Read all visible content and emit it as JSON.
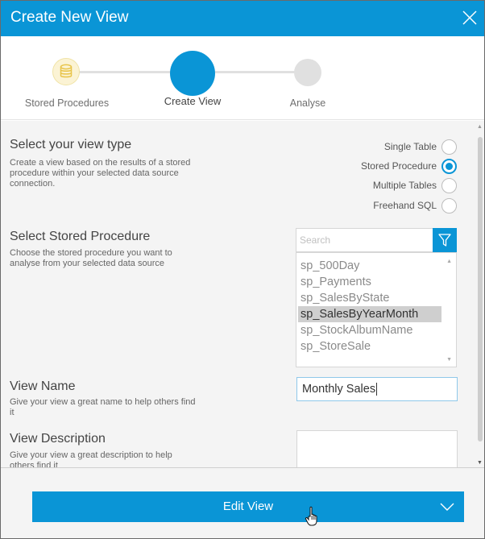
{
  "dialog": {
    "title": "Create New View",
    "close_icon": "close-icon"
  },
  "stepper": {
    "steps": [
      {
        "label": "Stored Procedures",
        "state": "done",
        "icon": "database-icon"
      },
      {
        "label": "Create View",
        "state": "active"
      },
      {
        "label": "Analyse",
        "state": "pending"
      }
    ]
  },
  "view_type": {
    "title": "Select your view type",
    "description_lines": [
      "Create a view based on the results of a stored",
      "procedure within your selected data source",
      "connection."
    ],
    "options": [
      {
        "label": "Single Table",
        "checked": false
      },
      {
        "label": "Stored Procedure",
        "checked": true
      },
      {
        "label": "Multiple Tables",
        "checked": false
      },
      {
        "label": "Freehand SQL",
        "checked": false
      }
    ]
  },
  "stored_procedure": {
    "title": "Select Stored Procedure",
    "description_lines": [
      "Choose the stored procedure you want to",
      "analyse from your selected data source"
    ],
    "search_placeholder": "Search",
    "filter_icon": "filter-icon",
    "items": [
      {
        "label": "sp_500Day",
        "selected": false
      },
      {
        "label": "sp_Payments",
        "selected": false
      },
      {
        "label": "sp_SalesByState",
        "selected": false
      },
      {
        "label": "sp_SalesByYearMonth",
        "selected": true
      },
      {
        "label": "sp_StockAlbumName",
        "selected": false
      },
      {
        "label": "sp_StoreSale",
        "selected": false
      }
    ]
  },
  "view_name": {
    "title": "View Name",
    "description_lines": [
      "Give your view a great name to help others find",
      "it"
    ],
    "value": "Monthly Sales"
  },
  "view_description": {
    "title": "View Description",
    "description_lines": [
      "Give your view a great description to help",
      "others find it"
    ],
    "value": ""
  },
  "footer": {
    "edit_button_label": "Edit View",
    "chevron_icon": "chevron-down-icon"
  },
  "colors": {
    "accent": "#0a95d6",
    "step_done_bg": "#fbf3d4",
    "step_done_icon": "#e8c44a",
    "step_pending": "#e0e0e0",
    "panel_bg": "#f4f4f4"
  }
}
